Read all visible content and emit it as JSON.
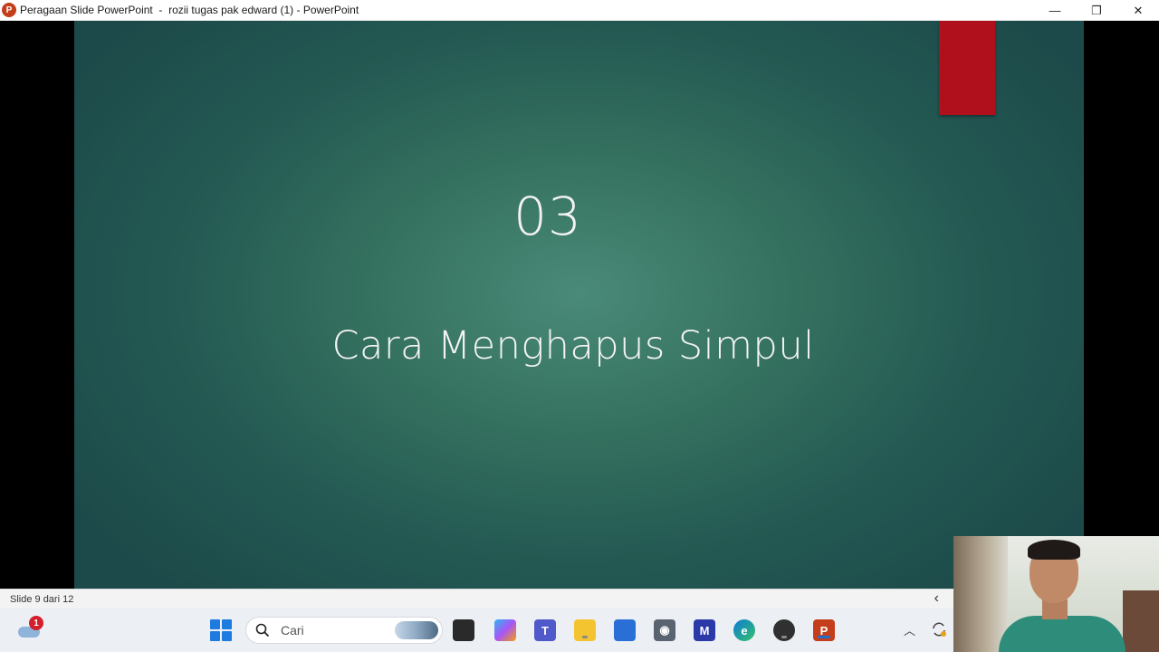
{
  "window": {
    "title": "Peragaan Slide PowerPoint  -  rozii tugas pak edward (1) - PowerPoint",
    "app_icon_letter": "P",
    "controls": {
      "minimize": "—",
      "restore": "❐",
      "close": "✕"
    }
  },
  "slide": {
    "section_number": "03",
    "heading": "Cara Menghapus Simpul",
    "accent_color": "#b0101b",
    "background_color": "#35715f"
  },
  "status_bar": {
    "slide_counter": "Slide 9 dari 12",
    "back_icon": "chevron-left-icon"
  },
  "taskbar": {
    "weather_badge": "1",
    "search_placeholder": "Cari",
    "pinned_apps": [
      {
        "name": "task-view",
        "glyph": "▪"
      },
      {
        "name": "copilot",
        "glyph": "✦"
      },
      {
        "name": "teams",
        "glyph": "T"
      },
      {
        "name": "file-explorer",
        "glyph": "▬"
      },
      {
        "name": "microsoft-store",
        "glyph": "▦"
      },
      {
        "name": "camera",
        "glyph": "◉"
      },
      {
        "name": "app-m",
        "glyph": "M"
      },
      {
        "name": "edge",
        "glyph": "e"
      },
      {
        "name": "obs",
        "glyph": "●"
      },
      {
        "name": "powerpoint",
        "glyph": "P"
      }
    ],
    "tray_chevron": "^"
  }
}
